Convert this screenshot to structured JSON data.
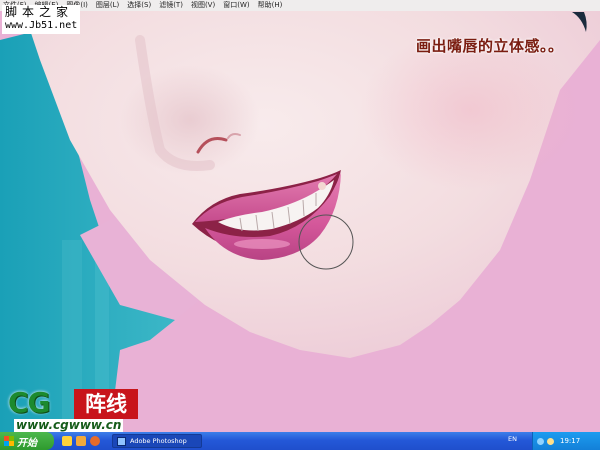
{
  "menu": {
    "items": [
      "文件(F)",
      "编辑(E)",
      "图像(I)",
      "图层(L)",
      "选择(S)",
      "滤镜(T)",
      "视图(V)",
      "窗口(W)",
      "帮助(H)"
    ]
  },
  "watermark": {
    "site_name": "脚本之家",
    "site_url": "www.Jb51.net"
  },
  "caption": "画出嘴唇的立体感。。",
  "logo": {
    "letters": "CG",
    "tagline": "阵线",
    "url": "www.cgwww.cn"
  },
  "taskbar": {
    "start_label": "开始",
    "task_label": "Adobe Photoshop",
    "language": "EN",
    "clock": "19:17"
  },
  "colors": {
    "background_pink": "#e9b1d5",
    "teal": "#2a9fb1",
    "skin": "#f3dde0",
    "lip": "#d8609c"
  },
  "icons": [
    "windows-flag-icon",
    "ie-icon",
    "folder-icon",
    "media-icon",
    "photoshop-icon",
    "network-icon",
    "volume-icon"
  ]
}
